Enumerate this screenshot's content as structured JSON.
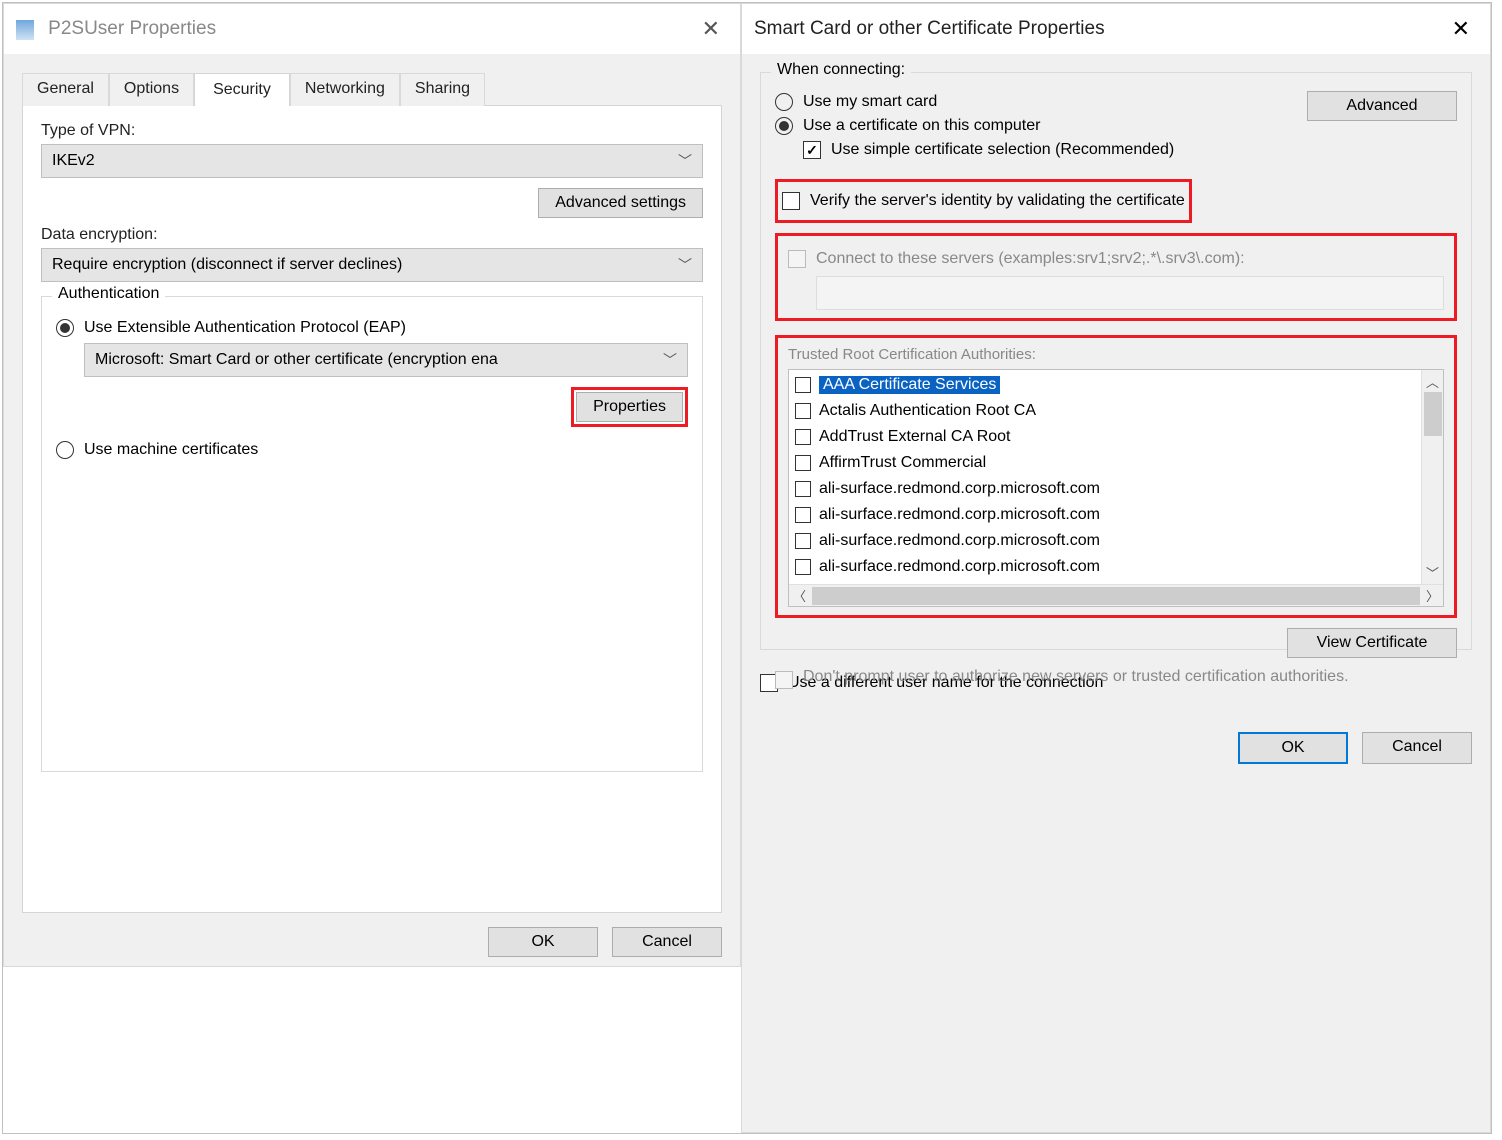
{
  "left": {
    "title": "P2SUser Properties",
    "tabs": [
      "General",
      "Options",
      "Security",
      "Networking",
      "Sharing"
    ],
    "active_tab": "Security",
    "vpn_type_label": "Type of VPN:",
    "vpn_type_value": "IKEv2",
    "advanced_settings": "Advanced settings",
    "data_enc_label": "Data encryption:",
    "data_enc_value": "Require encryption (disconnect if server declines)",
    "auth_legend": "Authentication",
    "radio_eap": "Use Extensible Authentication Protocol (EAP)",
    "eap_select_value": "Microsoft: Smart Card or other certificate (encryption ena",
    "properties_btn": "Properties",
    "radio_machine": "Use machine certificates",
    "ok": "OK",
    "cancel": "Cancel"
  },
  "right": {
    "title": "Smart Card or other Certificate Properties",
    "when_legend": "When connecting:",
    "radio_smart": "Use my smart card",
    "radio_cert": "Use a certificate on this computer",
    "check_simple": "Use simple certificate selection (Recommended)",
    "advanced_btn": "Advanced",
    "check_verify": "Verify the server's identity by validating the certificate",
    "check_connect_servers": "Connect to these servers (examples:srv1;srv2;.*\\.srv3\\.com):",
    "trusted_label": "Trusted Root Certification Authorities:",
    "ca_items": [
      "AAA Certificate Services",
      "Actalis Authentication Root CA",
      "AddTrust External CA Root",
      "AffirmTrust Commercial",
      "ali-surface.redmond.corp.microsoft.com",
      "ali-surface.redmond.corp.microsoft.com",
      "ali-surface.redmond.corp.microsoft.com",
      "ali-surface.redmond.corp.microsoft.com"
    ],
    "view_cert": "View Certificate",
    "dont_prompt": "Don't prompt user to authorize new servers or trusted certification authorities.",
    "use_diff_user": "Use a different user name for the connection",
    "ok": "OK",
    "cancel": "Cancel"
  }
}
